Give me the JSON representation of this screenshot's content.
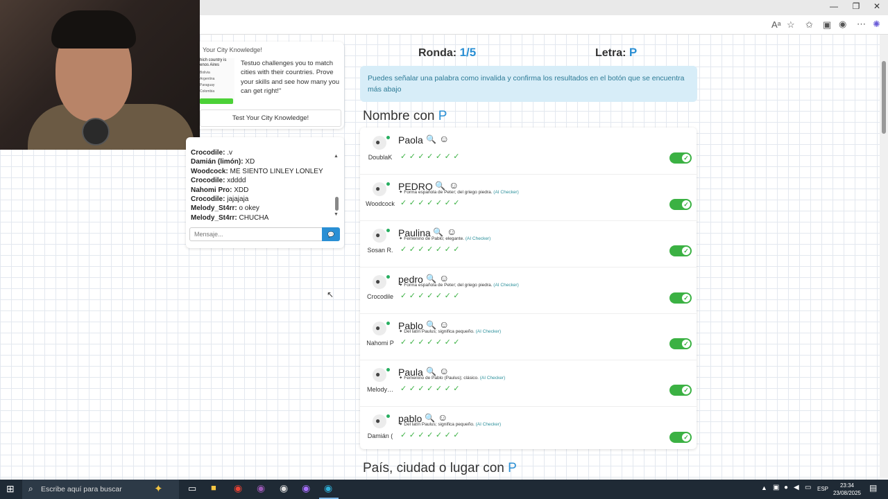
{
  "game": {
    "round_label": "Ronda:",
    "round_value": "1/5",
    "letter_label": "Letra:",
    "letter_value": "P",
    "notice": "Puedes señalar una palabra como invalida y confirma los resultados en el botón que se encuentra más abajo",
    "section1_title": "Nombre con",
    "section1_letter": "P",
    "section2_title": "País, ciudad o lugar con",
    "section2_letter": "P"
  },
  "ad": {
    "title": "Your City Knowledge!",
    "text": "Testuo challenges you to match cities with their countries. Prove your skills and see how many you can get right!\"",
    "question": "hich country is enos Aires",
    "options": [
      "Bolivia",
      "Argentina",
      "Paraguay",
      "Colombia"
    ],
    "button": "Test Your City Knowledge!"
  },
  "chat": {
    "messages": [
      {
        "user": "Crocodile:",
        "text": ".v"
      },
      {
        "user": "Damián (limón):",
        "text": "XD"
      },
      {
        "user": "Woodcock:",
        "text": "ME SIENTO LINLEY LONLEY"
      },
      {
        "user": "Crocodile:",
        "text": "xdddd"
      },
      {
        "user": "Nahomi Pro:",
        "text": "XDD"
      },
      {
        "user": "Crocodile:",
        "text": "jajajaja"
      },
      {
        "user": "Melody_St4rr:",
        "text": "o okey"
      },
      {
        "user": "Melody_St4rr:",
        "text": "CHUCHA"
      }
    ],
    "placeholder": "Mensaje..."
  },
  "answers": [
    {
      "user": "DoublaK",
      "word": "Paola",
      "desc": ""
    },
    {
      "user": "Woodcock",
      "word": "PEDRO",
      "desc": "Forma española de Peter; del griego piedra.",
      "tag": "(AI Checker)"
    },
    {
      "user": "Sosan R.",
      "word": "Paulina",
      "desc": "Femenino de Pablo; elegante.",
      "tag": "(AI Checker)"
    },
    {
      "user": "Crocodile",
      "word": "pedro",
      "desc": "Forma española de Peter; del griego piedra.",
      "tag": "(AI Checker)"
    },
    {
      "user": "Nahomi P",
      "word": "Pablo",
      "desc": "Del latín Paulus; significa pequeño.",
      "tag": "(AI Checker)"
    },
    {
      "user": "Melody…",
      "word": "Paula",
      "desc": "Femenino de Pablo (Paulus); clásico.",
      "tag": "(AI Checker)"
    },
    {
      "user": "Damián (",
      "word": "pablo",
      "desc": "Del latín Paulus; significa pequeño.",
      "tag": "(AI Checker)"
    }
  ],
  "taskbar": {
    "search_placeholder": "Escribe aquí para buscar",
    "lang": "ESP",
    "time": "23:34",
    "date": "23/08/2025"
  },
  "icons": {
    "check": "✓",
    "search": "🔍",
    "smile": "☺",
    "send": "💬",
    "user": "👤"
  },
  "colors": {
    "accent_blue": "#2a8fd4",
    "toggle_green": "#3bb143",
    "notice_bg": "#d7edf8"
  }
}
